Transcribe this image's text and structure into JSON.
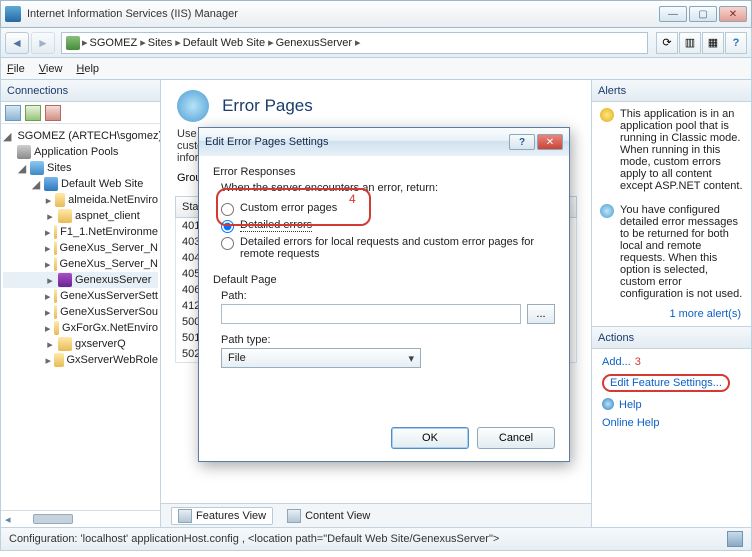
{
  "window": {
    "title": "Internet Information Services (IIS) Manager"
  },
  "breadcrumb": {
    "root": "SGOMEZ",
    "sites": "Sites",
    "dws": "Default Web Site",
    "gx": "GenexusServer"
  },
  "menu": {
    "file": "File",
    "view": "View",
    "help": "Help"
  },
  "connections": {
    "header": "Connections",
    "server": "SGOMEZ (ARTECH\\sgomez)",
    "pools": "Application Pools",
    "sites": "Sites",
    "dws": "Default Web Site",
    "children": {
      "c0": "almeida.NetEnviro",
      "c1": "aspnet_client",
      "c2": "F1_1.NetEnvironme",
      "c3": "GeneXus_Server_N",
      "c4": "GeneXus_Server_N",
      "c5": "GenexusServer",
      "c6": "GeneXusServerSett",
      "c7": "GeneXusServerSou",
      "c8": "GxForGx.NetEnviro",
      "c9": "gxserverQ",
      "c10": "GxServerWebRole"
    }
  },
  "page": {
    "title": "Error Pages",
    "desc": "Use this feature to configure HTTP error responses. The error responses can be custom error pages, or detailed error messages that contain troubleshooting information.",
    "groupby": "Group by:",
    "header": "Status Code",
    "codes": {
      "0": "401",
      "1": "403",
      "2": "404",
      "3": "405",
      "4": "406",
      "5": "412",
      "6": "500",
      "7": "501",
      "8": "502"
    }
  },
  "tabs": {
    "features": "Features View",
    "content": "Content View"
  },
  "alerts": {
    "header": "Alerts",
    "a1": "This application is in an application pool that is running in Classic mode. When running in this mode, custom errors apply to all content except ASP.NET content.",
    "a2": "You have configured detailed error messages to be returned for both local and remote requests. When this option is selected, custom error configuration is not used.",
    "more": "1 more alert(s)"
  },
  "actions": {
    "header": "Actions",
    "add": "Add...",
    "addnum": "3",
    "edit": "Edit Feature Settings...",
    "help": "Help",
    "online": "Online Help"
  },
  "statusbar": {
    "text": "Configuration: 'localhost' applicationHost.config , <location path=\"Default Web Site/GenexusServer\">"
  },
  "dialog": {
    "title": "Edit Error Pages Settings",
    "group": "Error Responses",
    "when": "When the server encounters an error, return:",
    "r1": "Custom error pages",
    "r2": "Detailed errors",
    "r3": "Detailed errors for local requests and custom error pages for remote requests",
    "defpage": "Default Page",
    "path": "Path:",
    "pathvalue": "",
    "browse": "...",
    "pathtype": "Path type:",
    "pathtypesel": "File",
    "ok": "OK",
    "cancel": "Cancel",
    "num4": "4"
  }
}
